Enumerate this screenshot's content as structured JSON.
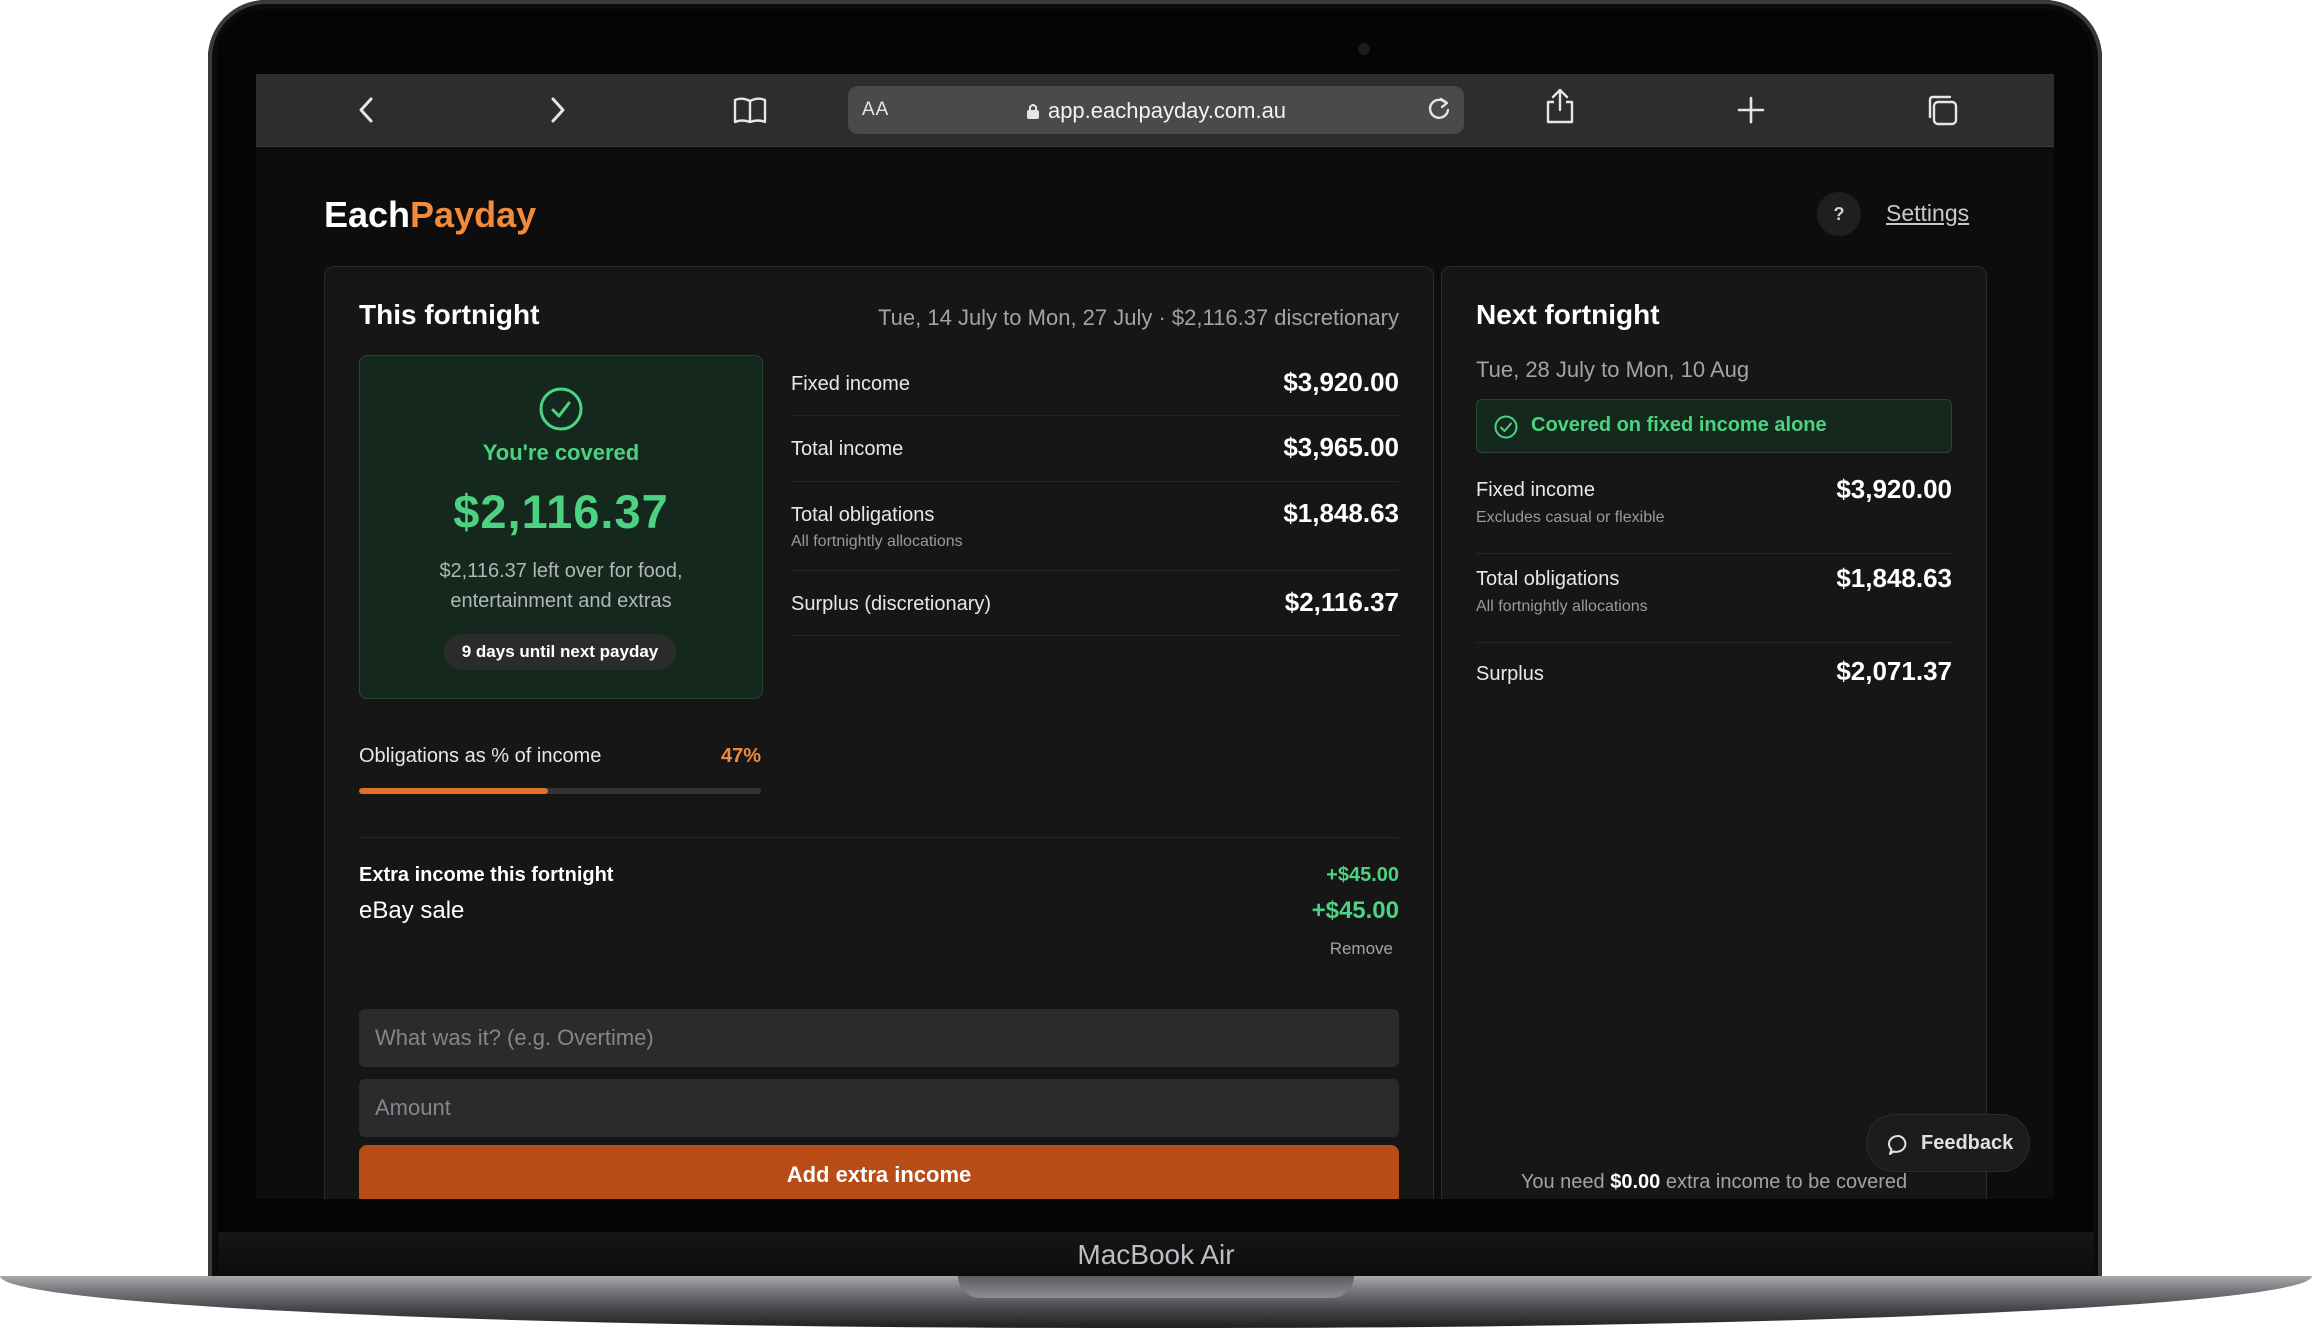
{
  "device": {
    "label": "MacBook Air"
  },
  "browser": {
    "aa": "AA",
    "url": "app.eachpayday.com.au"
  },
  "app": {
    "logo_each": "Each",
    "logo_payday": "Payday",
    "help": "?",
    "settings": "Settings"
  },
  "this_fortnight": {
    "title": "This fortnight",
    "range": "Tue, 14 July to Mon, 27 July · $2,116.37 discretionary",
    "status": "You're covered",
    "amount": "$2,116.37",
    "leftover": "$2,116.37 left over for food, entertainment and extras",
    "days": "9 days until next payday",
    "rows": [
      {
        "label": "Fixed income",
        "sub": "",
        "value": "$3,920.00"
      },
      {
        "label": "Total income",
        "sub": "",
        "value": "$3,965.00"
      },
      {
        "label": "Total obligations",
        "sub": "All fortnightly allocations",
        "value": "$1,848.63"
      },
      {
        "label": "Surplus (discretionary)",
        "sub": "",
        "value": "$2,116.37"
      }
    ],
    "obligations_label": "Obligations as % of income",
    "obligations_pct": "47%",
    "obligations_fraction": 0.47,
    "extra_title": "Extra income this fortnight",
    "extra_total": "+$45.00",
    "extra_items": [
      {
        "name": "eBay sale",
        "amount": "+$45.00",
        "remove": "Remove"
      }
    ],
    "form": {
      "what_placeholder": "What was it? (e.g. Overtime)",
      "amount_placeholder": "Amount",
      "add_button": "Add extra income"
    }
  },
  "next_fortnight": {
    "title": "Next fortnight",
    "range": "Tue, 28 July to Mon, 10 Aug",
    "banner": "Covered on fixed income alone",
    "rows": [
      {
        "label": "Fixed income",
        "sub": "Excludes casual or flexible",
        "value": "$3,920.00"
      },
      {
        "label": "Total obligations",
        "sub": "All fortnightly allocations",
        "value": "$1,848.63"
      },
      {
        "label": "Surplus",
        "sub": "",
        "value": "$2,071.37"
      }
    ],
    "need_prefix": "You need",
    "need_amount": "$0.00",
    "need_suffix": "extra income to be covered"
  },
  "feedback": {
    "label": "Feedback"
  },
  "colors": {
    "accent": "#f28a3c",
    "positive": "#4cd382",
    "button": "#b84c16"
  }
}
